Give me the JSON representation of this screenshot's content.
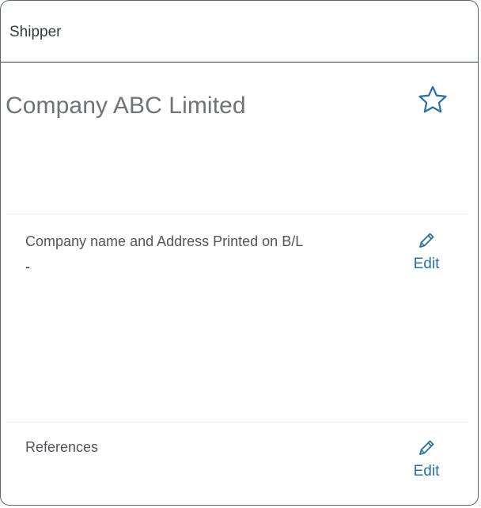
{
  "header": {
    "title": "Shipper"
  },
  "company": {
    "name": "Company ABC Limited"
  },
  "favorite": {
    "icon": "star-outline-icon",
    "color": "#2a6fa0"
  },
  "printed_address": {
    "label": "Company name and Address Printed on B/L",
    "value": "-",
    "edit_label": "Edit",
    "edit_icon": "pencil-icon"
  },
  "references": {
    "label": "References",
    "edit_label": "Edit",
    "edit_icon": "pencil-icon"
  },
  "colors": {
    "accent": "#2a6fa0",
    "border": "#5a6470",
    "text_muted": "#6f7378"
  }
}
